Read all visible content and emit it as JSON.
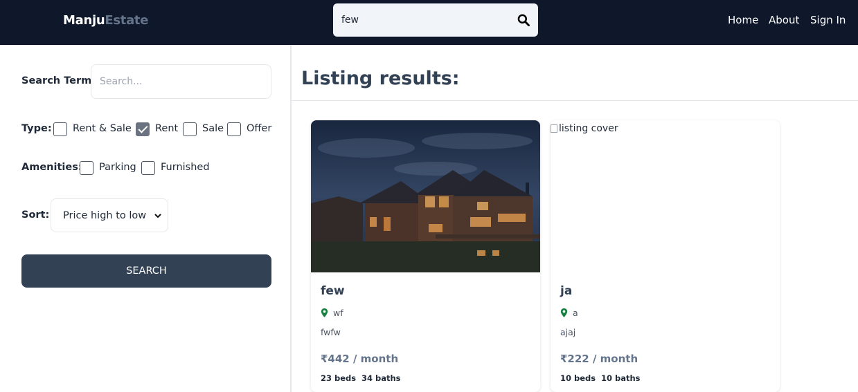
{
  "header": {
    "logo_part1": "Manju",
    "logo_part2": "Estate",
    "search_value": "few",
    "nav": {
      "home": "Home",
      "about": "About",
      "sign_in": "Sign In"
    }
  },
  "sidebar": {
    "search_term_label": "Search Term:",
    "search_placeholder": "Search...",
    "type_label": "Type:",
    "type_options": [
      {
        "label": "Rent & Sale",
        "checked": false
      },
      {
        "label": "Rent",
        "checked": true
      },
      {
        "label": "Sale",
        "checked": false
      },
      {
        "label": "Offer",
        "checked": false
      }
    ],
    "amenities_label": "Amenities:",
    "amenities_options": [
      {
        "label": "Parking",
        "checked": false
      },
      {
        "label": "Furnished",
        "checked": false
      }
    ],
    "sort_label": "Sort:",
    "sort_value": "Price high to low",
    "search_button": "SEARCH"
  },
  "main": {
    "title": "Listing results:",
    "listings": [
      {
        "name": "few",
        "address": "wf",
        "description": "fwfw",
        "price": "₹442 / month",
        "beds": "23 beds",
        "baths": "34 baths",
        "image_alt": ""
      },
      {
        "name": "ja",
        "address": "a",
        "description": "ajaj",
        "price": "₹222 / month",
        "beds": "10 beds",
        "baths": "10 baths",
        "image_alt": "listing cover"
      }
    ]
  },
  "colors": {
    "header_bg": "#0f172a",
    "button_bg": "#334155",
    "pin": "#15803d"
  },
  "icons": {
    "search": "search-icon",
    "pin": "map-pin-icon",
    "chevron": "chevron-down-icon"
  }
}
